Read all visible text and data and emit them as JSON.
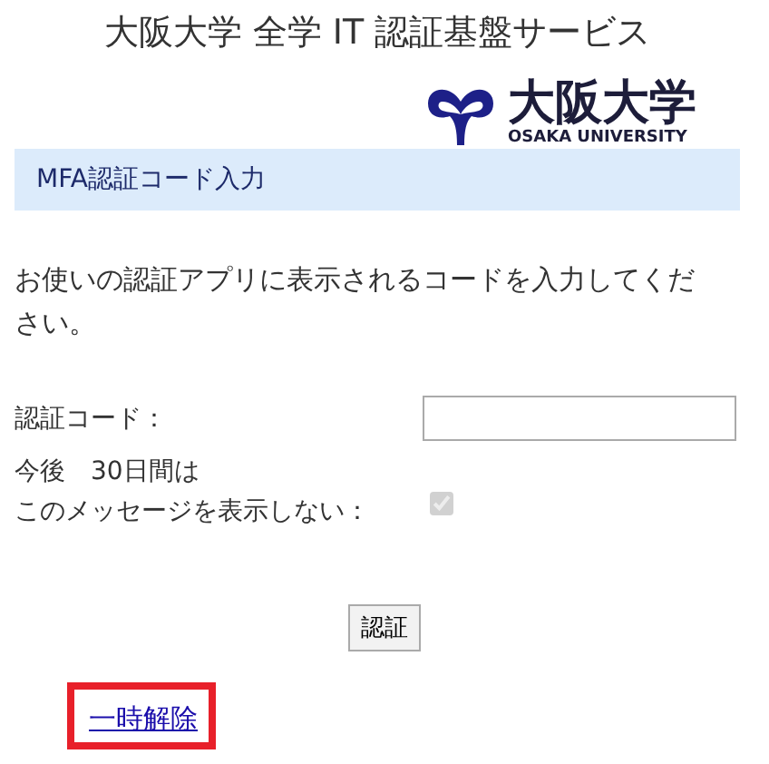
{
  "page_title": "大阪大学 全学 IT 認証基盤サービス",
  "logo": {
    "name": "大阪大学",
    "subtitle": "OSAKA UNIVERSITY"
  },
  "section_header": "MFA認証コード入力",
  "instructions": "お使いの認証アプリに表示されるコードを入力してください。",
  "code_field": {
    "label": "認証コード："
  },
  "remember": {
    "label_line_1": "今後　30日間は",
    "label_line_2": "このメッセージを表示しない：",
    "checked": true,
    "disabled": true
  },
  "submit_button": "認証",
  "suspend_link": {
    "label": "一時解除",
    "highlighted": true
  }
}
